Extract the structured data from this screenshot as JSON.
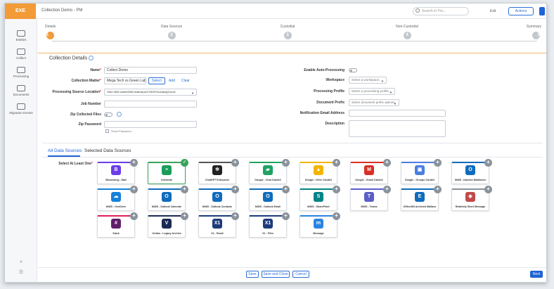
{
  "header": {
    "logo_text": "EXE",
    "title": "Collection Demo - PM",
    "search_placeholder": "Search in Pro...",
    "link_label": "Exit",
    "button_label": "Actions"
  },
  "sidebar": {
    "items": [
      {
        "label": "Entities",
        "icon": "entities-icon"
      },
      {
        "label": "Collect",
        "icon": "collect-icon"
      },
      {
        "label": "Processing",
        "icon": "processing-icon"
      },
      {
        "label": "Documents",
        "icon": "documents-icon"
      },
      {
        "label": "Migration Events",
        "icon": "migration-icon"
      }
    ]
  },
  "stepper": {
    "steps": [
      {
        "label": "Details",
        "num": "1"
      },
      {
        "label": "Data Sources",
        "num": "2"
      },
      {
        "label": "Custodial",
        "num": "3"
      },
      {
        "label": "Non-Custodial",
        "num": "4"
      },
      {
        "label": "Summary",
        "num": "5"
      }
    ]
  },
  "details": {
    "title": "Collection Details",
    "name_label": "Name",
    "name_value": "Collect Demo",
    "matter_label": "Collection Matter",
    "matter_value": "Mega Tech vs Green Labs",
    "select_label": "Select",
    "add_label": "Add",
    "clear_label": "Clear",
    "location_label": "Processing Source Location",
    "location_value": "\\\\Stor-0802.cluster0080.relativity.one\\T802\\ProcessingSource",
    "job_label": "Job Number",
    "zip_files_label": "Zip Collected Files",
    "zip_password_label": "Zip Password",
    "show_password_label": "Show Password",
    "auto_processing_label": "Enable Auto-Processing",
    "workspace_label": "Workspace",
    "workspace_placeholder": "Select a workspace...",
    "processing_profile_label": "Processing Profile",
    "processing_profile_placeholder": "Select a processing profile...",
    "document_prefix_label": "Document Prefix",
    "document_prefix_placeholder": "Select document prefix options",
    "notification_label": "Notification Email Address",
    "description_label": "Description"
  },
  "sources": {
    "tab_all": "All Data Sources",
    "tab_selected": "Selected Data Sources",
    "select_label": "Select At Least One",
    "cards": [
      {
        "label": "Bloomberg - Mail",
        "logo": "B",
        "color": "#6a3de8",
        "accent": "#6a3de8"
      },
      {
        "label": "Cellebrite",
        "logo": "≡",
        "color": "#1a9d5b",
        "accent": "#3aa35b",
        "selected": true
      },
      {
        "label": "ChatGPT Enterprise",
        "logo": "✲",
        "color": "#222222",
        "accent": "#555555"
      },
      {
        "label": "Google - Chat OAuth2",
        "logo": "▰",
        "color": "#1ea362",
        "accent": "#1ea362"
      },
      {
        "label": "Google - Drive OAuth2",
        "logo": "▲",
        "color": "#f5b400",
        "accent": "#f5b400"
      },
      {
        "label": "Google - Gmail OAuth2",
        "logo": "M",
        "color": "#d93025",
        "accent": "#d93025"
      },
      {
        "label": "Google - Groups OAuth2",
        "logo": "▣",
        "color": "#4a7fe0",
        "accent": "#4a7fe0"
      },
      {
        "label": "M365 - Inactive Mailboxes",
        "logo": "O",
        "color": "#0f6cbd",
        "accent": "#0f6cbd"
      },
      {
        "label": "M365 - OneDrive",
        "logo": "☁",
        "color": "#1580d9",
        "accent": "#1580d9"
      },
      {
        "label": "M365 - Outlook Calendar",
        "logo": "O",
        "color": "#0f6cbd",
        "accent": "#0f6cbd"
      },
      {
        "label": "M365 - Outlook Contacts",
        "logo": "O",
        "color": "#0f6cbd",
        "accent": "#0f6cbd"
      },
      {
        "label": "M365 - Outlook Email",
        "logo": "O",
        "color": "#0f6cbd",
        "accent": "#0f6cbd"
      },
      {
        "label": "M365 - SharePoint",
        "logo": "S",
        "color": "#038387",
        "accent": "#038387"
      },
      {
        "label": "M365 - Teams",
        "logo": "T",
        "color": "#5b5fc7",
        "accent": "#5b5fc7"
      },
      {
        "label": "Office365 Archived Mailbox",
        "logo": "E",
        "color": "#0f6cbd",
        "accent": "#0f6cbd"
      },
      {
        "label": "Relativity Short Message",
        "logo": "◈",
        "color": "#c24a4a",
        "accent": "#8a939c"
      },
      {
        "label": "Slack",
        "logo": "#",
        "color": "#611f69",
        "accent": "#e01e5a"
      },
      {
        "label": "Veritas - Legacy Archive",
        "logo": "V",
        "color": "#1b2a52",
        "accent": "#1b2a52"
      },
      {
        "label": "X1 - Email",
        "logo": "X1",
        "color": "#1c3b7a",
        "accent": "#1c3b7a"
      },
      {
        "label": "X1 - Files",
        "logo": "X1",
        "color": "#1c3b7a",
        "accent": "#1c3b7a"
      },
      {
        "label": "Message",
        "logo": "m",
        "color": "#2a84e0",
        "accent": "#2a84e0"
      }
    ]
  },
  "footer": {
    "save_label": "Save",
    "save_close_label": "Save and Close",
    "cancel_label": "Cancel",
    "next_label": "Next"
  },
  "colors": {
    "accent": "#f29b38",
    "primary": "#1f63d6",
    "selected": "#3aa35b"
  }
}
